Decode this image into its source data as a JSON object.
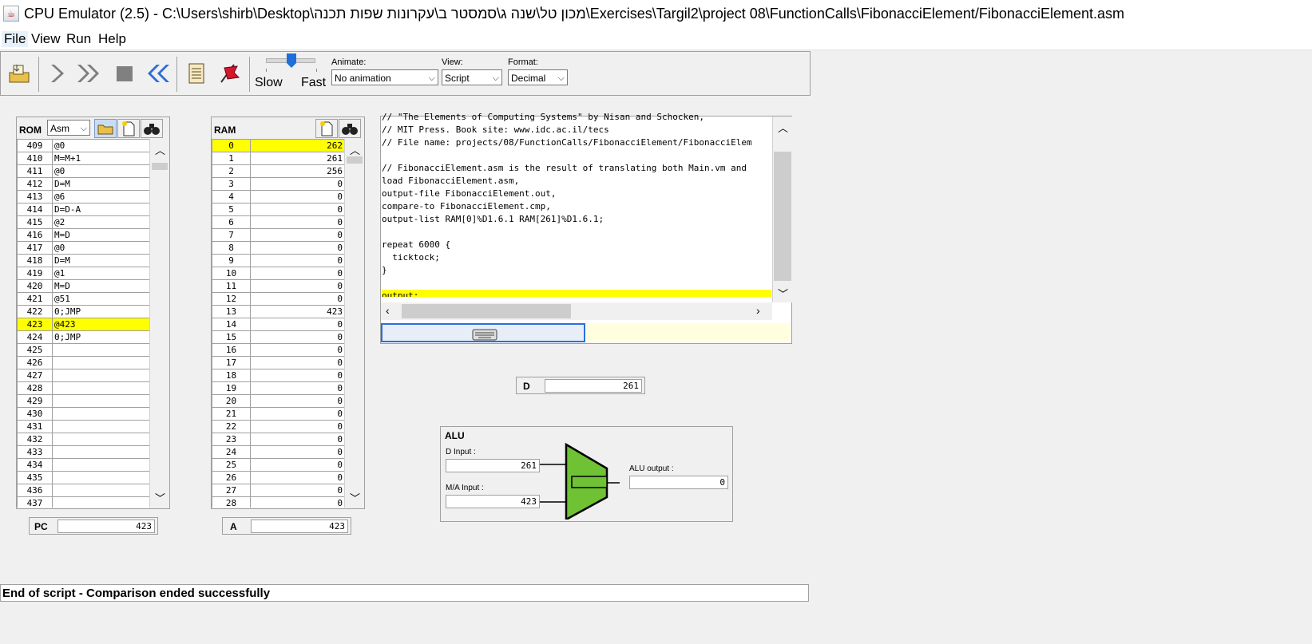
{
  "window": {
    "title": "CPU Emulator (2.5) - C:\\Users\\shirb\\Desktop\\מכון טל\\שנה ג\\סמסטר ב\\עקרונות שפות תכנה\\Exercises\\Targil2\\project 08\\FunctionCalls\\FibonacciElement/FibonacciElement.asm",
    "icon": "java-cup-icon"
  },
  "menu": {
    "file": "File",
    "view": "View",
    "run": "Run",
    "help": "Help"
  },
  "toolbar": {
    "slider_slow": "Slow",
    "slider_fast": "Fast",
    "animate_label": "Animate:",
    "animate_value": "No animation",
    "view_label": "View:",
    "view_value": "Script",
    "format_label": "Format:",
    "format_value": "Decimal",
    "accent": "#1e6fd9"
  },
  "rom": {
    "title": "ROM",
    "mode": "Asm",
    "rows": [
      [
        "409",
        "@0"
      ],
      [
        "410",
        "M=M+1"
      ],
      [
        "411",
        "@0"
      ],
      [
        "412",
        "D=M"
      ],
      [
        "413",
        "@6"
      ],
      [
        "414",
        "D=D-A"
      ],
      [
        "415",
        "@2"
      ],
      [
        "416",
        "M=D"
      ],
      [
        "417",
        "@0"
      ],
      [
        "418",
        "D=M"
      ],
      [
        "419",
        "@1"
      ],
      [
        "420",
        "M=D"
      ],
      [
        "421",
        "@51"
      ],
      [
        "422",
        "0;JMP"
      ],
      [
        "423",
        "@423"
      ],
      [
        "424",
        "0;JMP"
      ],
      [
        "425",
        ""
      ],
      [
        "426",
        ""
      ],
      [
        "427",
        ""
      ],
      [
        "428",
        ""
      ],
      [
        "429",
        ""
      ],
      [
        "430",
        ""
      ],
      [
        "431",
        ""
      ],
      [
        "432",
        ""
      ],
      [
        "433",
        ""
      ],
      [
        "434",
        ""
      ],
      [
        "435",
        ""
      ],
      [
        "436",
        ""
      ],
      [
        "437",
        ""
      ]
    ],
    "highlight_index": 14
  },
  "ram": {
    "title": "RAM",
    "rows": [
      [
        "0",
        "262"
      ],
      [
        "1",
        "261"
      ],
      [
        "2",
        "256"
      ],
      [
        "3",
        "0"
      ],
      [
        "4",
        "0"
      ],
      [
        "5",
        "0"
      ],
      [
        "6",
        "0"
      ],
      [
        "7",
        "0"
      ],
      [
        "8",
        "0"
      ],
      [
        "9",
        "0"
      ],
      [
        "10",
        "0"
      ],
      [
        "11",
        "0"
      ],
      [
        "12",
        "0"
      ],
      [
        "13",
        "423"
      ],
      [
        "14",
        "0"
      ],
      [
        "15",
        "0"
      ],
      [
        "16",
        "0"
      ],
      [
        "17",
        "0"
      ],
      [
        "18",
        "0"
      ],
      [
        "19",
        "0"
      ],
      [
        "20",
        "0"
      ],
      [
        "21",
        "0"
      ],
      [
        "22",
        "0"
      ],
      [
        "23",
        "0"
      ],
      [
        "24",
        "0"
      ],
      [
        "25",
        "0"
      ],
      [
        "26",
        "0"
      ],
      [
        "27",
        "0"
      ],
      [
        "28",
        "0"
      ]
    ],
    "highlight_index": 0
  },
  "registers": {
    "pc_label": "PC",
    "pc_value": "423",
    "a_label": "A",
    "a_value": "423",
    "d_label": "D",
    "d_value": "261"
  },
  "script": {
    "lines": [
      "// \"The Elements of Computing Systems\" by Nisan and Schocken,",
      "// MIT Press. Book site: www.idc.ac.il/tecs",
      "// File name: projects/08/FunctionCalls/FibonacciElement/FibonacciElem",
      "",
      "// FibonacciElement.asm is the result of translating both Main.vm and",
      "load FibonacciElement.asm,",
      "output-file FibonacciElement.out,",
      "compare-to FibonacciElement.cmp,",
      "output-list RAM[0]%D1.6.1 RAM[261]%D1.6.1;",
      "",
      "repeat 6000 {",
      "  ticktock;",
      "}",
      "",
      "output;"
    ],
    "highlight_index": 14
  },
  "alu": {
    "title": "ALU",
    "d_input_label": "D Input :",
    "d_input_value": "261",
    "ma_input_label": "M/A Input :",
    "ma_input_value": "423",
    "output_label": "ALU output :",
    "output_value": "0",
    "color": "#6fc234"
  },
  "status": {
    "message": "End of script - Comparison ended successfully"
  }
}
